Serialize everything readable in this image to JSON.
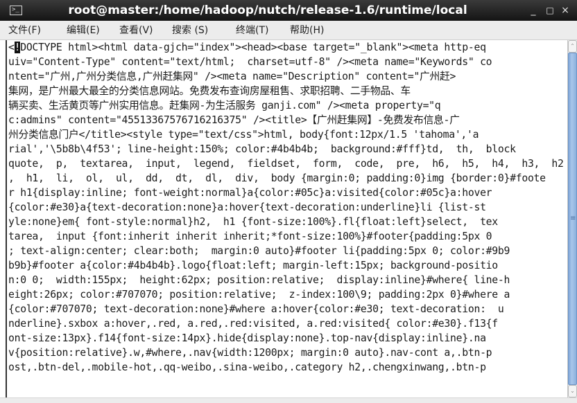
{
  "window": {
    "title": "root@master:/home/hadoop/nutch/release-1.6/runtime/local",
    "icons": {
      "app": "terminal-icon",
      "minimize": "_",
      "maximize": "□",
      "close": "×"
    },
    "app_icon_glyph": ">_"
  },
  "menubar": {
    "items": [
      {
        "label": "文件(F)"
      },
      {
        "label": "编辑(E)"
      },
      {
        "label": "查看(V)"
      },
      {
        "label": "搜索 (S)"
      },
      {
        "label": "终端(T)"
      },
      {
        "label": "帮助(H)"
      }
    ]
  },
  "terminal": {
    "cursor_char": "!",
    "first_line_prefix": "<",
    "first_line_rest": "DOCTYPE html><html data-gjch=\"index\"><head><base target=\"_blank\"><meta http-eq",
    "lines": [
      "uiv=\"Content-Type\" content=\"text/html;  charset=utf-8\" /><meta name=\"Keywords\" co",
      "ntent=\"广州,广州分类信息,广州赶集网\" /><meta name=\"Description\" content=\"广州赶>",
      "集网，是广州最大最全的分类信息网站。免费发布查询房屋租售、求职招聘、二手物品、车",
      "辆买卖、生活黄页等广州实用信息。赶集网-为生活服务 ganji.com\" /><meta property=\"q",
      "c:admins\" content=\"45513367576716216375\" /><title>【广州赶集网】-免费发布信息-广",
      "州分类信息门户</title><style type=\"text/css\">html, body{font:12px/1.5 'tahoma','a",
      "rial','\\5b8b\\4f53'; line-height:150%; color:#4b4b4b;  background:#fff}td,  th,  block",
      "quote,  p,  textarea,  input,  legend,  fieldset,  form,  code,  pre,  h6,  h5,  h4,  h3,  h2",
      ",  h1,  li,  ol,  ul,  dd,  dt,  dl,  div,  body {margin:0; padding:0}img {border:0}#foote",
      "r h1{display:inline; font-weight:normal}a{color:#05c}a:visited{color:#05c}a:hover",
      "{color:#e30}a{text-decoration:none}a:hover{text-decoration:underline}li {list-st",
      "yle:none}em{ font-style:normal}h2,  h1 {font-size:100%}.fl{float:left}select,  tex",
      "tarea,  input {font:inherit inherit inherit;*font-size:100%}#footer{padding:5px 0",
      "; text-align:center; clear:both;  margin:0 auto}#footer li{padding:5px 0; color:#9b9",
      "b9b}#footer a{color:#4b4b4b}.logo{float:left; margin-left:15px; background-positio",
      "n:0 0;  width:155px;  height:62px; position:relative;  display:inline}#where{ line-h",
      "eight:26px; color:#707070; position:relative;  z-index:100\\9; padding:2px 0}#where a",
      "{color:#707070; text-decoration:none}#where a:hover{color:#e30; text-decoration:  u",
      "nderline}.sxbox a:hover,.red, a.red,.red:visited, a.red:visited{ color:#e30}.f13{f",
      "ont-size:13px}.f14{font-size:14px}.hide{display:none}.top-nav{display:inline}.na",
      "v{position:relative}.w,#where,.nav{width:1200px; margin:0 auto}.nav-cont a,.btn-p",
      "ost,.btn-del,.mobile-hot,.qq-weibo,.sina-weibo,.category h2,.chengxinwang,.btn-p"
    ]
  },
  "scrollbar": {
    "up_glyph": "⌃",
    "down_glyph": "⌄",
    "grip_glyph": "≡",
    "position_fraction": 0.0
  }
}
